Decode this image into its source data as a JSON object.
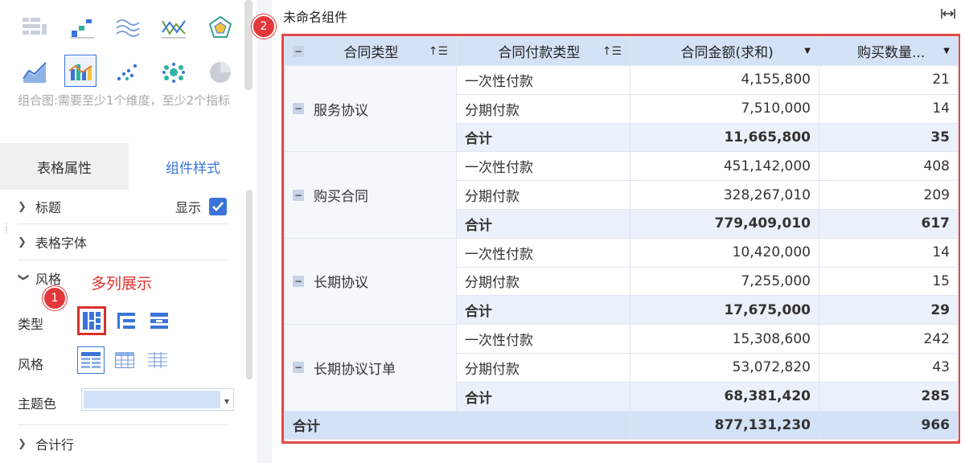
{
  "left_panel": {
    "chart_types": [
      "grouped-grid-icon",
      "bar-step-icon",
      "line-wave-icon",
      "line-cross-icon",
      "radar-icon",
      "area-line-icon",
      "combo-chart-icon",
      "scatter-icon",
      "bubble-icon",
      "pie-icon"
    ],
    "chart_hint": "组合图:需要至少1个维度，至少2个指标",
    "tabs": [
      "表格属性",
      "组件样式"
    ],
    "sections": {
      "title": "标题",
      "show_label": "显示",
      "font": "表格字体",
      "style": "风格",
      "style_note": "多列展示",
      "type_label": "类型",
      "style_label": "风格",
      "theme_label": "主题色",
      "total_row": "合计行"
    },
    "badge_1": "1",
    "accent_color": "#3a74d9"
  },
  "component": {
    "title": "未命名组件",
    "badge_2": "2"
  },
  "table": {
    "headers": [
      "合同类型",
      "合同付款类型",
      "合同金额(求和)",
      "购买数量..."
    ],
    "groups": [
      {
        "name": "服务协议",
        "rows": [
          [
            "一次性付款",
            "4,155,800",
            "21"
          ],
          [
            "分期付款",
            "7,510,000",
            "14"
          ]
        ],
        "subtotal": [
          "合计",
          "11,665,800",
          "35"
        ]
      },
      {
        "name": "购买合同",
        "rows": [
          [
            "一次性付款",
            "451,142,000",
            "408"
          ],
          [
            "分期付款",
            "328,267,010",
            "209"
          ]
        ],
        "subtotal": [
          "合计",
          "779,409,010",
          "617"
        ]
      },
      {
        "name": "长期协议",
        "rows": [
          [
            "一次性付款",
            "10,420,000",
            "14"
          ],
          [
            "分期付款",
            "7,255,000",
            "15"
          ]
        ],
        "subtotal": [
          "合计",
          "17,675,000",
          "29"
        ]
      },
      {
        "name": "长期协议订单",
        "rows": [
          [
            "一次性付款",
            "15,308,600",
            "242"
          ],
          [
            "分期付款",
            "53,072,820",
            "43"
          ]
        ],
        "subtotal": [
          "合计",
          "68,381,420",
          "285"
        ]
      }
    ],
    "grand_total": [
      "合计",
      "877,131,230",
      "966"
    ]
  }
}
